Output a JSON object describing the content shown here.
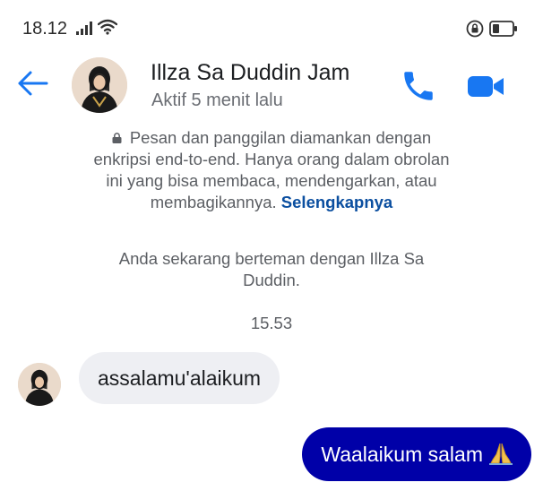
{
  "status_bar": {
    "time": "18.12"
  },
  "header": {
    "contact_name": "Illza Sa Duddin Jam",
    "active_status": "Aktif 5 menit lalu"
  },
  "encryption_notice": {
    "text": "Pesan dan panggilan diamankan dengan enkripsi end-to-end. Hanya orang dalam obrolan ini yang bisa membaca, mendengarkan, atau membagikannya.",
    "learn_more": "Selengkapnya"
  },
  "friend_notice": "Anda sekarang berteman dengan Illza Sa Duddin.",
  "timestamp": "15.53",
  "messages": {
    "incoming": "assalamu'alaikum",
    "outgoing": "Waalaikum salam"
  },
  "icons": {
    "back": "arrow-left",
    "call": "phone",
    "video": "video-camera",
    "emoji": "folded-hands"
  },
  "colors": {
    "accent": "#1877f2",
    "outgoing_bubble": "#0000a8",
    "incoming_bubble": "#eeeff3",
    "link": "#0b4fa0"
  }
}
